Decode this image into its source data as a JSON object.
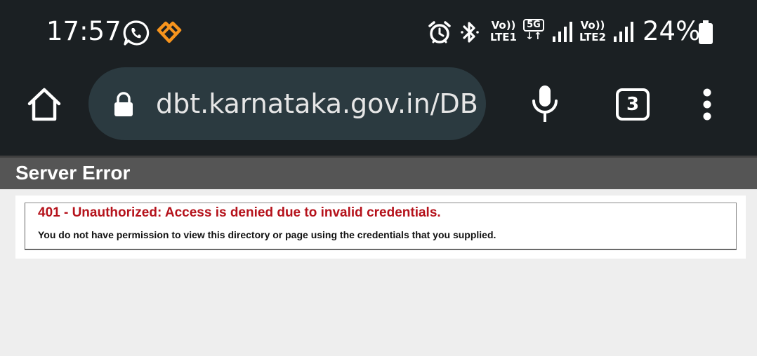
{
  "status_bar": {
    "time": "17:57",
    "net1_volte": "Vo))",
    "net1_lte": "LTE1",
    "fiveg": "5G",
    "fiveg_arrows": "↓↑",
    "net2_volte": "Vo))",
    "net2_lte": "LTE2",
    "battery_percent": "24%",
    "icons": [
      "whatsapp-icon",
      "heart-app-icon",
      "alarm-icon",
      "bluetooth-icon",
      "signal-icon",
      "battery-icon"
    ]
  },
  "browser": {
    "url": "dbt.karnataka.gov.in/DB",
    "tab_count": "3",
    "icons": [
      "home-icon",
      "lock-icon",
      "mic-icon",
      "menu-icon"
    ]
  },
  "page": {
    "header_title": "Server Error",
    "error_title": "401 - Unauthorized: Access is denied due to invalid credentials.",
    "error_description": "You do not have permission to view this directory or page using the credentials that you supplied."
  },
  "colors": {
    "chrome_bg": "#1b2023",
    "url_bar_bg": "#2b3a40",
    "header_bg": "#555555",
    "error_red": "#b5121b",
    "page_bg": "#eeeeee",
    "heart_orange": "#f7941d"
  }
}
